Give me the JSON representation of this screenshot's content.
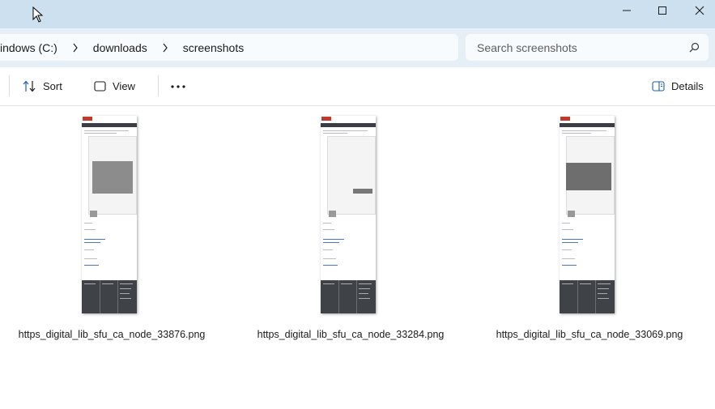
{
  "window": {
    "minimize_icon": "minimize-icon",
    "maximize_icon": "maximize-icon",
    "close_icon": "close-icon"
  },
  "address": {
    "crumbs": [
      "indows (C:)",
      "downloads",
      "screenshots"
    ],
    "separator_icon": "chevron-right-icon"
  },
  "search": {
    "placeholder": "Search screenshots",
    "icon": "search-icon"
  },
  "toolbar": {
    "sort_label": "Sort",
    "view_label": "View",
    "more_icon": "more-icon",
    "details_label": "Details"
  },
  "files": [
    {
      "name": "https_digital_lib_sfu_ca_node_33876.png"
    },
    {
      "name": "https_digital_lib_sfu_ca_node_33284.png"
    },
    {
      "name": "https_digital_lib_sfu_ca_node_33069.png"
    }
  ]
}
